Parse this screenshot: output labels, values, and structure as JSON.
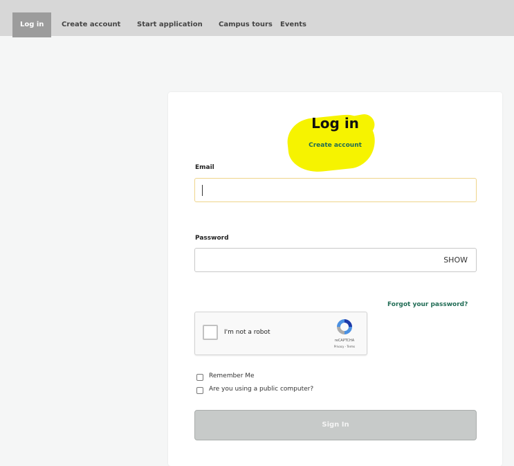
{
  "nav": {
    "items": [
      {
        "label": "Log in",
        "active": true
      },
      {
        "label": "Create account"
      },
      {
        "label": "Start application"
      },
      {
        "label": "Campus tours"
      },
      {
        "label": "Events"
      }
    ]
  },
  "login": {
    "title": "Log in",
    "create_account_link": "Create account",
    "email_label": "Email",
    "email_value": "",
    "password_label": "Password",
    "password_value": "",
    "show_label": "SHOW",
    "forgot_link": "Forgot your password?",
    "recaptcha": {
      "label": "I'm not a robot",
      "brand": "reCAPTCHA",
      "terms": "Privacy - Terms"
    },
    "remember_label": "Remember Me",
    "public_computer_label": "Are you using a public computer?",
    "sign_in_label": "Sign In"
  },
  "colors": {
    "link_green": "#1f6b54",
    "highlight_yellow": "#f6f300",
    "nav_bg": "#d7d7d7",
    "nav_active_bg": "#9c9c9c"
  }
}
